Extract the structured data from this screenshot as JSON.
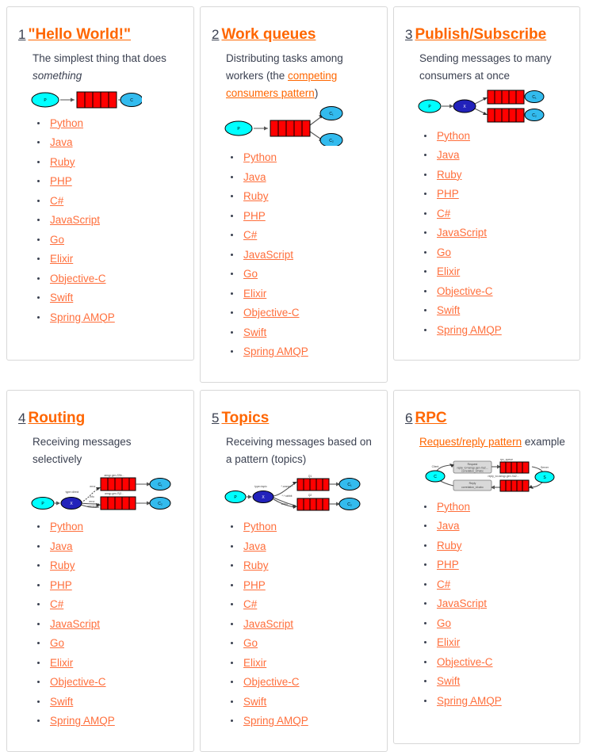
{
  "page": {
    "accent_orange": "#ff6600",
    "link_orange": "#ff6f3c",
    "text_color": "#3b4151",
    "card_border": "#d8d8d8",
    "queue_red": "#ff0000",
    "producer_cyan": "#00ffff",
    "consumer_blue": "#33bbee",
    "exchange_navy": "#2222bb"
  },
  "languages": [
    "Python",
    "Java",
    "Ruby",
    "PHP",
    "C#",
    "JavaScript",
    "Go",
    "Elixir",
    "Objective-C",
    "Swift",
    "Spring AMQP"
  ],
  "tutorials": [
    {
      "number": "1",
      "title": "\"Hello World!\"",
      "desc_prefix": "The simplest thing that does ",
      "desc_em": "something",
      "desc_link": "",
      "desc_suffix": "",
      "diagram": "hello-world-diagram",
      "diagram_labels": {
        "producer": "P",
        "consumer": "C"
      }
    },
    {
      "number": "2",
      "title": "Work queues",
      "desc_prefix": "Distributing tasks among workers (the ",
      "desc_em": "",
      "desc_link": "competing consumers pattern",
      "desc_suffix": ")",
      "diagram": "work-queues-diagram",
      "diagram_labels": {
        "producer": "P",
        "consumer1": "C₁",
        "consumer2": "C₂"
      }
    },
    {
      "number": "3",
      "title": "Publish/Subscribe",
      "desc_prefix": "Sending messages to many consumers at once",
      "desc_em": "",
      "desc_link": "",
      "desc_suffix": "",
      "diagram": "publish-subscribe-diagram",
      "diagram_labels": {
        "producer": "P",
        "exchange": "X",
        "consumer1": "C₁",
        "consumer2": "C₂"
      }
    },
    {
      "number": "4",
      "title": "Routing",
      "desc_prefix": "Receiving messages selectively",
      "desc_em": "",
      "desc_link": "",
      "desc_suffix": "",
      "diagram": "routing-diagram",
      "diagram_labels": {
        "producer": "P",
        "exchange": "X",
        "consumer1": "C₁",
        "consumer2": "C₂",
        "binding_error": "error",
        "binding_info": "info",
        "binding_warning": "warning",
        "exchange_type": "type=direct",
        "queue1": "amqp.gen-S9b...",
        "queue2": "amqp.gen-Rj2..."
      }
    },
    {
      "number": "5",
      "title": "Topics",
      "desc_prefix": "Receiving messages based on a pattern (topics)",
      "desc_em": "",
      "desc_link": "",
      "desc_suffix": "",
      "diagram": "topics-diagram",
      "diagram_labels": {
        "producer": "P",
        "exchange": "X",
        "consumer1": "C₁",
        "consumer2": "C₂",
        "exchange_type": "type=topic",
        "binding1": "*.orange.*",
        "binding2": "*.*.rabbit",
        "binding3": "lazy.#",
        "queue1": "Q1",
        "queue2": "Q2"
      }
    },
    {
      "number": "6",
      "title": "RPC",
      "desc_prefix": "",
      "desc_em": "",
      "desc_link": "Request/reply pattern",
      "desc_suffix": " example",
      "diagram": "rpc-diagram",
      "diagram_labels": {
        "client": "C",
        "server": "S",
        "client_label": "Client",
        "server_label": "Server",
        "request_box": "Request reply_to=amqp.gen-Xa2... correlation_id=abc",
        "reply_box": "Reply correlation_id=abc",
        "queue1": "rpc_queue",
        "queue2": "reply_to=amqp.gen-Xa2..."
      }
    }
  ]
}
